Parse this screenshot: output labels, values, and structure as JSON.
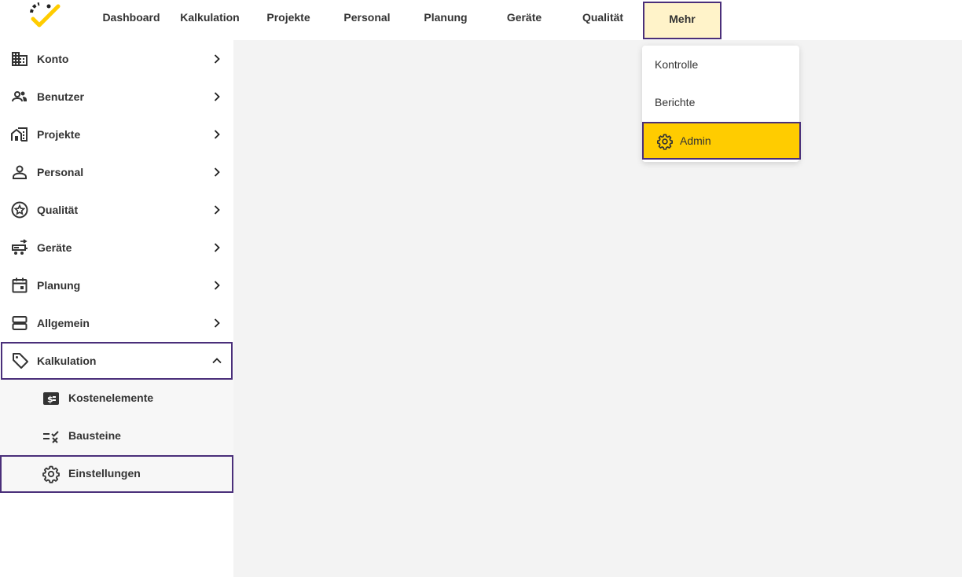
{
  "nav": {
    "items": [
      {
        "label": "Dashboard"
      },
      {
        "label": "Kalkulation"
      },
      {
        "label": "Projekte"
      },
      {
        "label": "Personal"
      },
      {
        "label": "Planung"
      },
      {
        "label": "Geräte"
      },
      {
        "label": "Qualität"
      },
      {
        "label": "Mehr"
      }
    ],
    "active": "Mehr"
  },
  "dropdown": {
    "items": [
      {
        "label": "Kontrolle"
      },
      {
        "label": "Berichte"
      },
      {
        "label": "Admin",
        "icon": "gear-icon"
      }
    ],
    "selected": "Admin"
  },
  "sidebar": {
    "items": [
      {
        "label": "Konto",
        "icon": "building-icon"
      },
      {
        "label": "Benutzer",
        "icon": "users-icon"
      },
      {
        "label": "Projekte",
        "icon": "house-building-icon"
      },
      {
        "label": "Personal",
        "icon": "person-icon"
      },
      {
        "label": "Qualität",
        "icon": "star-badge-icon"
      },
      {
        "label": "Geräte",
        "icon": "vehicle-icon"
      },
      {
        "label": "Planung",
        "icon": "calendar-icon"
      },
      {
        "label": "Allgemein",
        "icon": "storage-icon"
      },
      {
        "label": "Kalkulation",
        "icon": "tag-icon"
      }
    ],
    "expanded": "Kalkulation",
    "sub_items": [
      {
        "label": "Kostenelemente",
        "icon": "money-icon"
      },
      {
        "label": "Bausteine",
        "icon": "rule-icon"
      },
      {
        "label": "Einstellungen",
        "icon": "gear-icon"
      }
    ],
    "selected_sub": "Einstellungen"
  },
  "colors": {
    "accent": "#ffcc00",
    "highlight_border": "#4a2f7a",
    "active_nav_bg": "#fff3c9",
    "content_bg": "#f3f3f3"
  }
}
